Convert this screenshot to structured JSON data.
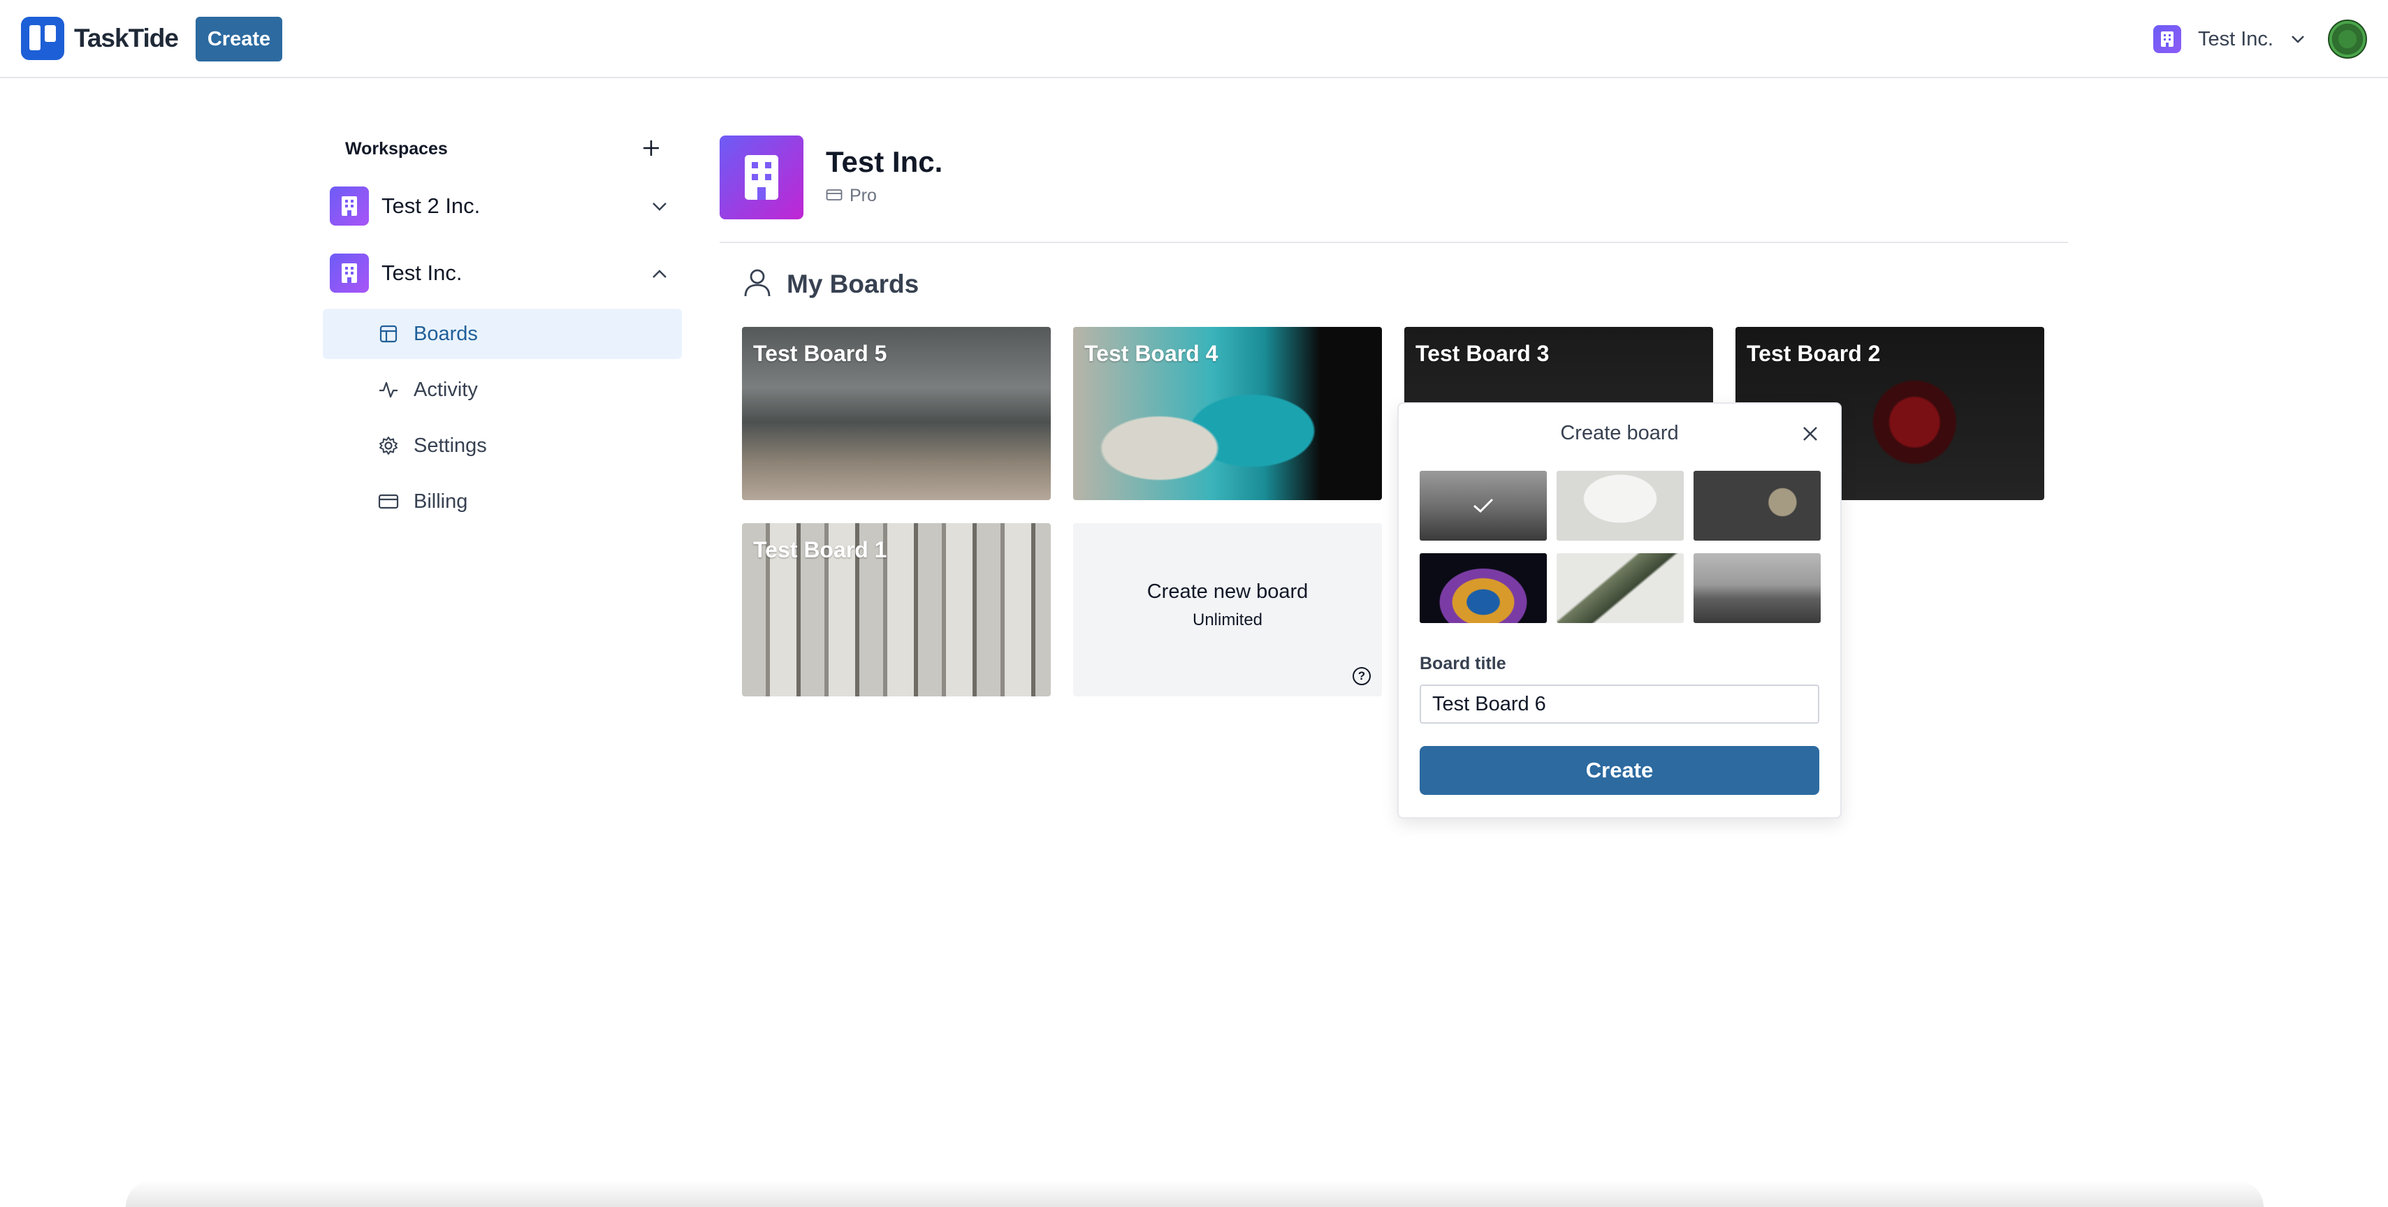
{
  "app": {
    "name": "TaskTide"
  },
  "topbar": {
    "create_label": "Create",
    "org_name": "Test Inc."
  },
  "sidebar": {
    "title": "Workspaces",
    "workspaces": [
      {
        "name": "Test 2 Inc.",
        "expanded": false
      },
      {
        "name": "Test Inc.",
        "expanded": true
      }
    ],
    "items": [
      {
        "label": "Boards",
        "icon": "layout-icon",
        "active": true
      },
      {
        "label": "Activity",
        "icon": "activity-icon",
        "active": false
      },
      {
        "label": "Settings",
        "icon": "gear-icon",
        "active": false
      },
      {
        "label": "Billing",
        "icon": "credit-card-icon",
        "active": false
      }
    ]
  },
  "org": {
    "title": "Test Inc.",
    "plan": "Pro"
  },
  "boards": {
    "section_title": "My Boards",
    "items": [
      {
        "title": "Test Board 5"
      },
      {
        "title": "Test Board 4"
      },
      {
        "title": "Test Board 3"
      },
      {
        "title": "Test Board 2"
      },
      {
        "title": "Test Board 1"
      }
    ],
    "new_board": {
      "title": "Create new board",
      "subtitle": "Unlimited"
    }
  },
  "popover": {
    "title": "Create board",
    "field_label": "Board title",
    "field_value": "Test Board 6",
    "submit_label": "Create",
    "selected_image": 1
  },
  "colors": {
    "primary": "#2c6aa0",
    "brand": "#1d5fd6",
    "active_bg": "#eaf3fd"
  }
}
